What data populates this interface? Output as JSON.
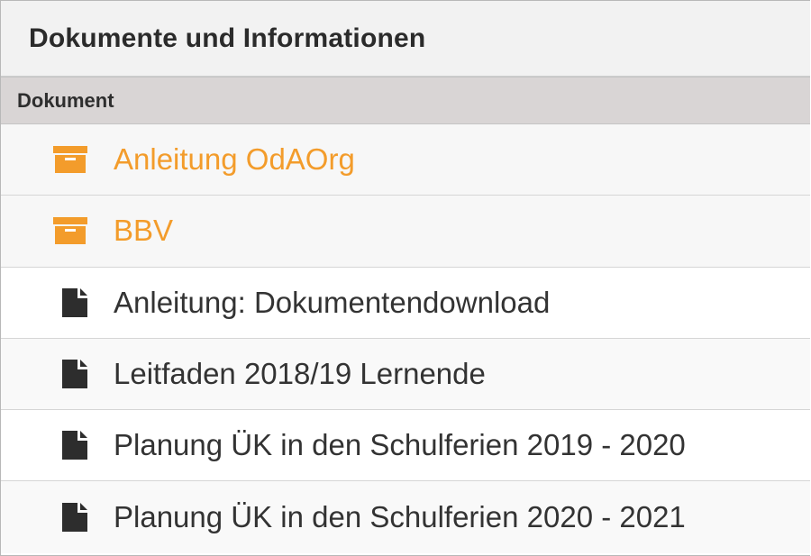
{
  "panel": {
    "title": "Dokumente und Informationen"
  },
  "table": {
    "column_header": "Dokument"
  },
  "items": [
    {
      "type": "folder",
      "label": "Anleitung OdAOrg",
      "icon": "archive-box-icon"
    },
    {
      "type": "folder",
      "label": "BBV",
      "icon": "archive-box-icon"
    },
    {
      "type": "file",
      "label": "Anleitung: Dokumentendownload",
      "icon": "file-icon"
    },
    {
      "type": "file",
      "label": "Leitfaden 2018/19 Lernende",
      "icon": "file-icon"
    },
    {
      "type": "file",
      "label": "Planung ÜK in den Schulferien 2019 - 2020",
      "icon": "file-icon"
    },
    {
      "type": "file",
      "label": "Planung ÜK in den Schulferien 2020 - 2021",
      "icon": "file-icon"
    }
  ],
  "colors": {
    "folder_accent": "#f39c2b",
    "file_text": "#333333",
    "column_header_bg": "#d9d5d5"
  }
}
